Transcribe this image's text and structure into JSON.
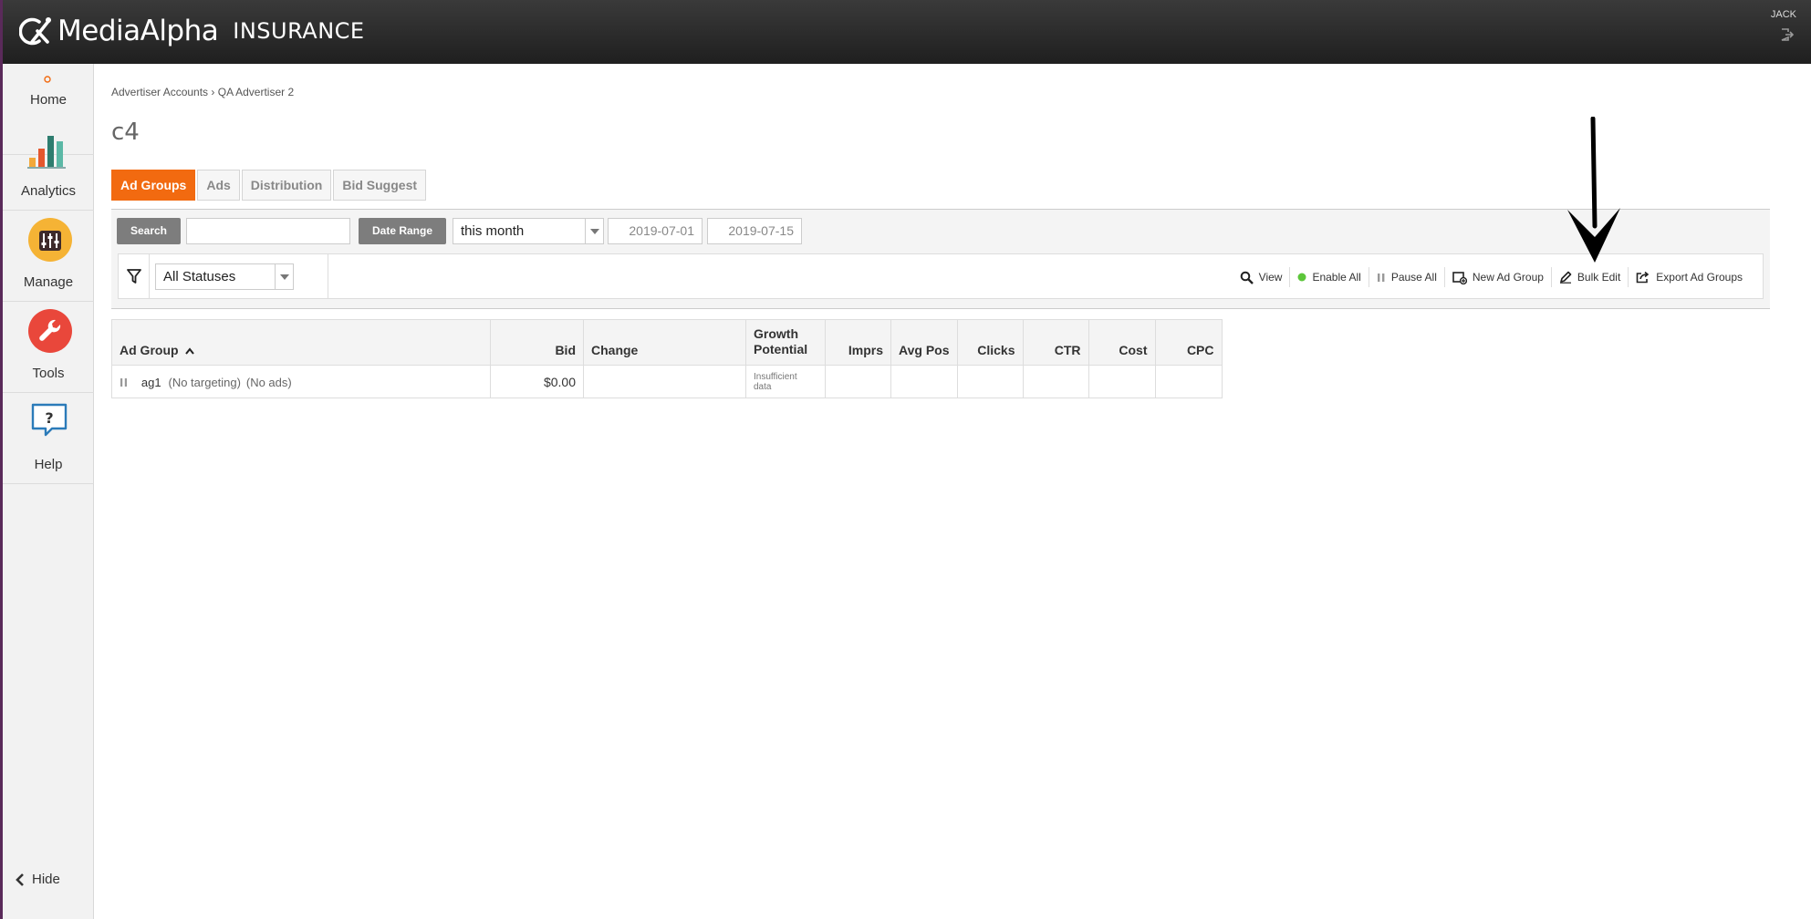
{
  "header": {
    "brand": "MediaAlpha",
    "product": "INSURANCE",
    "user": "JACK",
    "logout_icon": "logout-icon"
  },
  "sidebar": {
    "items": [
      {
        "label": "Home",
        "icon": "home-dot-icon"
      },
      {
        "label": "Analytics",
        "icon": "bar-chart-icon"
      },
      {
        "label": "Manage",
        "icon": "sliders-icon"
      },
      {
        "label": "Tools",
        "icon": "wrench-icon"
      },
      {
        "label": "Help",
        "icon": "help-bubble-icon"
      }
    ],
    "hide_label": "Hide"
  },
  "breadcrumb": {
    "parent": "Advertiser Accounts",
    "separator": "›",
    "current": "QA Advertiser 2"
  },
  "page_title": "c4",
  "tabs": [
    {
      "label": "Ad Groups",
      "active": true
    },
    {
      "label": "Ads"
    },
    {
      "label": "Distribution"
    },
    {
      "label": "Bid Suggest"
    }
  ],
  "search": {
    "button_label": "Search",
    "value": ""
  },
  "date_range": {
    "button_label": "Date Range",
    "preset": "this month",
    "start": "2019-07-01",
    "end": "2019-07-15"
  },
  "filter": {
    "status": "All Statuses"
  },
  "actions": [
    {
      "label": "View",
      "icon": "magnifier-icon"
    },
    {
      "label": "Enable All",
      "icon": "green-dot-icon"
    },
    {
      "label": "Pause All",
      "icon": "pause-icon"
    },
    {
      "label": "New Ad Group",
      "icon": "new-group-icon"
    },
    {
      "label": "Bulk Edit",
      "icon": "pencil-icon"
    },
    {
      "label": "Export Ad Groups",
      "icon": "export-icon"
    }
  ],
  "table": {
    "columns": [
      "Ad Group",
      "Bid",
      "Change",
      "Growth",
      "Potential",
      "Imprs",
      "Avg Pos",
      "Clicks",
      "CTR",
      "Cost",
      "CPC"
    ],
    "rows": [
      {
        "name": "ag1",
        "targeting": "(No targeting)",
        "ads": "(No ads)",
        "bid": "$0.00",
        "change": "",
        "growth_line1": "Insufficient",
        "growth_line2": "data",
        "imprs": "",
        "avg_pos": "",
        "clicks": "",
        "ctr": "",
        "cost": "",
        "cpc": ""
      }
    ]
  },
  "colors": {
    "accent": "#f26a10",
    "topbar": "#2a2a2a",
    "sidebar": "#f2f2f2"
  }
}
